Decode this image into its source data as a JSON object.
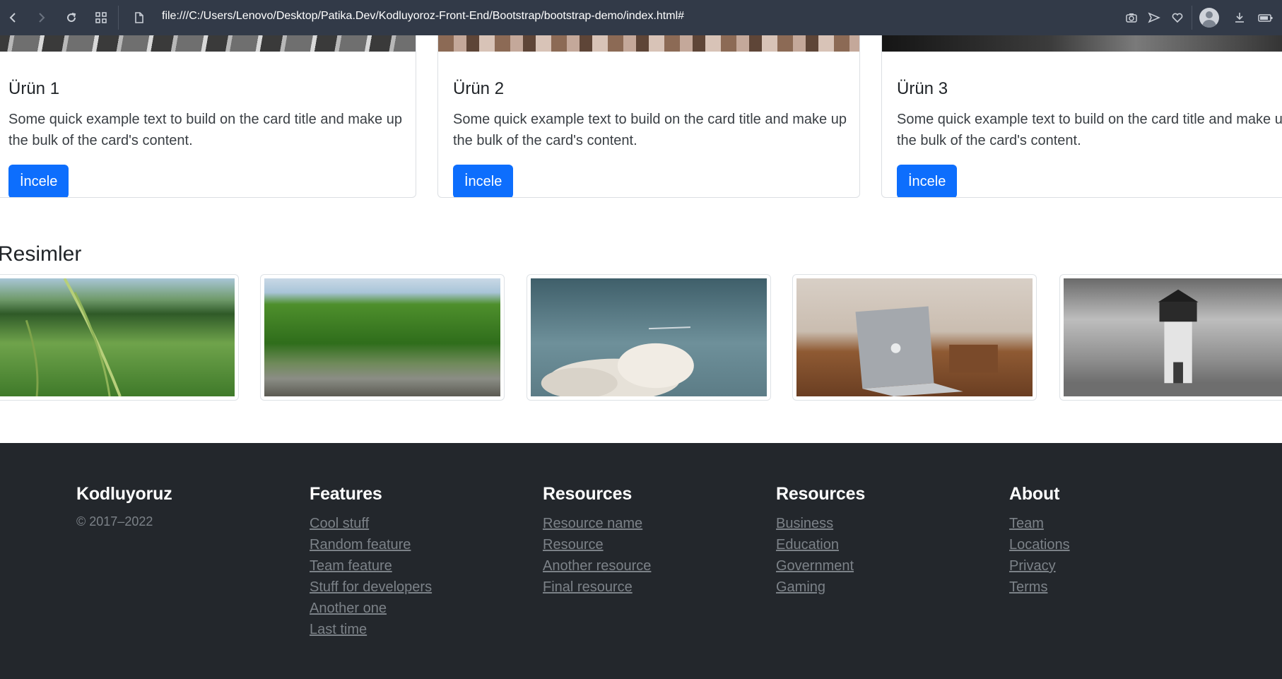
{
  "browser": {
    "url": "file:///C:/Users/Lenovo/Desktop/Patika.Dev/Kodluyoroz-Front-End/Bootstrap/bootstrap-demo/index.html#"
  },
  "cards": [
    {
      "title": "Ürün 1",
      "text": "Some quick example text to build on the card title and make up the bulk of the card's content.",
      "button": "İncele"
    },
    {
      "title": "Ürün 2",
      "text": "Some quick example text to build on the card title and make up the bulk of the card's content.",
      "button": "İncele"
    },
    {
      "title": "Ürün 3",
      "text": "Some quick example text to build on the card title and make up the bulk of the card's content.",
      "button": "İncele"
    }
  ],
  "gallery": {
    "title": "Resimler",
    "images": [
      "grass-field-photo",
      "forest-river-photo",
      "cloud-sky-photo",
      "laptop-desk-photo",
      "lighthouse-photo"
    ]
  },
  "footer": {
    "brand": "Kodluyoruz",
    "copyright": "© 2017–2022",
    "columns": [
      {
        "title": "Features",
        "links": [
          "Cool stuff",
          "Random feature",
          "Team feature",
          "Stuff for developers",
          "Another one",
          "Last time"
        ]
      },
      {
        "title": "Resources",
        "links": [
          "Resource name",
          "Resource",
          "Another resource",
          "Final resource"
        ]
      },
      {
        "title": "Resources",
        "links": [
          "Business",
          "Education",
          "Government",
          "Gaming"
        ]
      },
      {
        "title": "About",
        "links": [
          "Team",
          "Locations",
          "Privacy",
          "Terms"
        ]
      }
    ]
  },
  "colors": {
    "toolbar": "#323a48",
    "primary_button": "#0d6efd",
    "footer_bg": "#23272c",
    "footer_link": "#7c8288"
  }
}
